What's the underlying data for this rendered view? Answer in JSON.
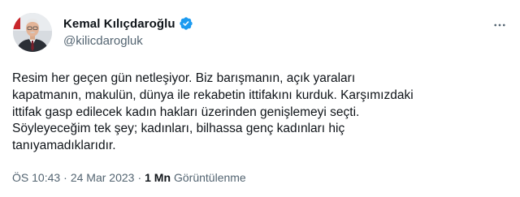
{
  "tweet": {
    "author": {
      "display_name": "Kemal Kılıçdaroğlu",
      "handle": "@kilicdarogluk",
      "verified": true,
      "verified_color": "#1d9bf0"
    },
    "text": "Resim her geçen gün netleşiyor. Biz barışmanın, açık yaraları\nkapatmanın, makulün, dünya ile rekabetin ittifakını kurduk. Karşımızdaki\nittifak gasp edilecek kadın hakları üzerinden genişlemeyi seçti.\nSöyleyeceğim tek şey; kadınları, bilhassa genç kadınları hiç\ntanıyamadıklarıdır.",
    "meta": {
      "time": "ÖS 10:43",
      "separator": "·",
      "date": "24 Mar 2023",
      "views_count": "1 Mn",
      "views_label": "Görüntülenme"
    },
    "icons": {
      "verified": "verified-badge-icon",
      "more": "more-options-icon"
    }
  }
}
